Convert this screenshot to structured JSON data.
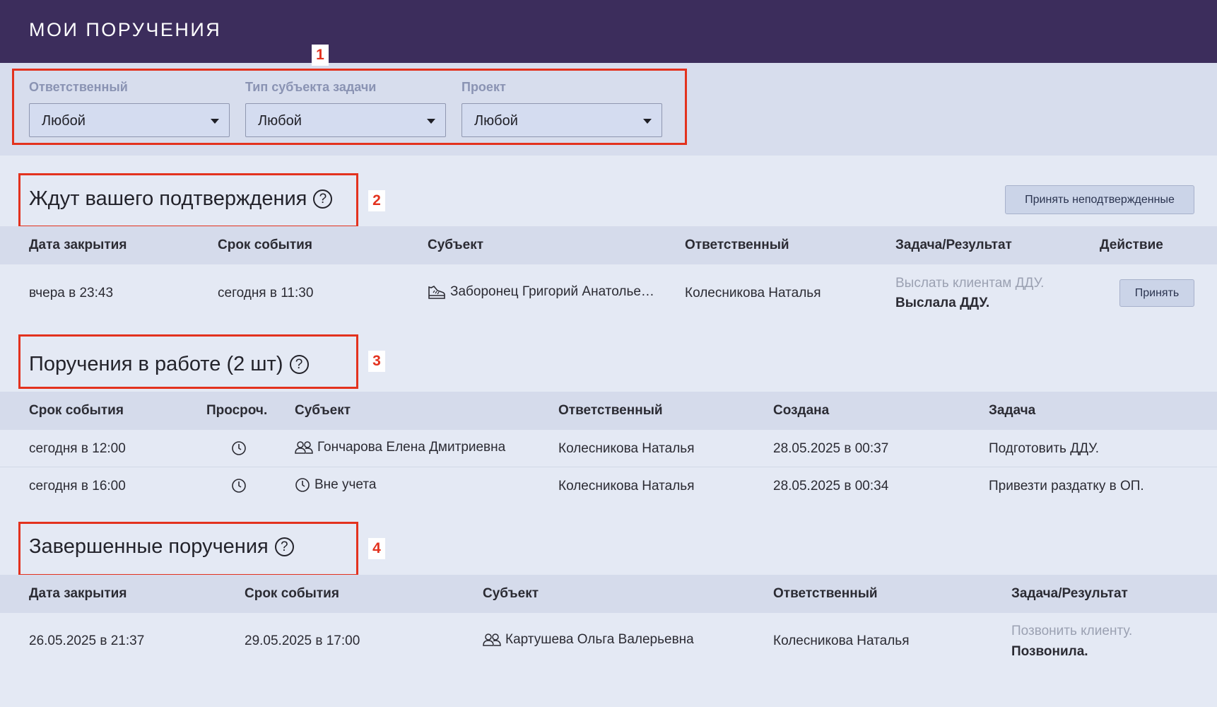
{
  "header": {
    "title": "МОИ ПОРУЧЕНИЯ"
  },
  "filters": [
    {
      "label": "Ответственный",
      "value": "Любой"
    },
    {
      "label": "Тип субъекта задачи",
      "value": "Любой"
    },
    {
      "label": "Проект",
      "value": "Любой"
    }
  ],
  "annotations": [
    "1",
    "2",
    "3",
    "4"
  ],
  "colors": {
    "header_bg": "#3c2d5c",
    "annotation": "#e3321e",
    "page_bg": "#e4e9f4"
  },
  "pending": {
    "title": "Ждут вашего подтверждения",
    "accept_all_label": "Принять неподтвержденные",
    "columns": [
      "Дата закрытия",
      "Срок события",
      "Субъект",
      "Ответственный",
      "Задача/Результат",
      "Действие"
    ],
    "rows": [
      {
        "closed": "вчера в 23:43",
        "due": "сегодня в 11:30",
        "subject_icon": "shoe-icon",
        "subject": "Заборонец Григорий Анатолье…",
        "responsible": "Колесникова Наталья",
        "task": "Выслать клиентам ДДУ.",
        "result": "Выслала ДДУ.",
        "action": "Принять"
      }
    ]
  },
  "in_work": {
    "title": "Поручения в работе (2 шт)",
    "columns": [
      "Срок события",
      "Просроч.",
      "Субъект",
      "Ответственный",
      "Создана",
      "Задача"
    ],
    "rows": [
      {
        "due": "сегодня в 12:00",
        "overdue_icon": "clock-icon",
        "subject_icon": "people-icon",
        "subject": "Гончарова Елена Дмитриевна",
        "responsible": "Колесникова Наталья",
        "created": "28.05.2025 в 00:37",
        "task": "Подготовить ДДУ."
      },
      {
        "due": "сегодня в 16:00",
        "overdue_icon": "clock-icon",
        "subject_icon": "clock-icon",
        "subject": "Вне учета",
        "responsible": "Колесникова Наталья",
        "created": "28.05.2025 в 00:34",
        "task": "Привезти раздатку в ОП."
      }
    ]
  },
  "completed": {
    "title": "Завершенные поручения",
    "columns": [
      "Дата закрытия",
      "Срок события",
      "Субъект",
      "Ответственный",
      "Задача/Результат"
    ],
    "rows": [
      {
        "closed": "26.05.2025 в 21:37",
        "due": "29.05.2025 в 17:00",
        "subject_icon": "people-icon",
        "subject": "Картушева Ольга Валерьевна",
        "responsible": "Колесникова Наталья",
        "task": "Позвонить клиенту.",
        "result": "Позвонила."
      }
    ]
  }
}
